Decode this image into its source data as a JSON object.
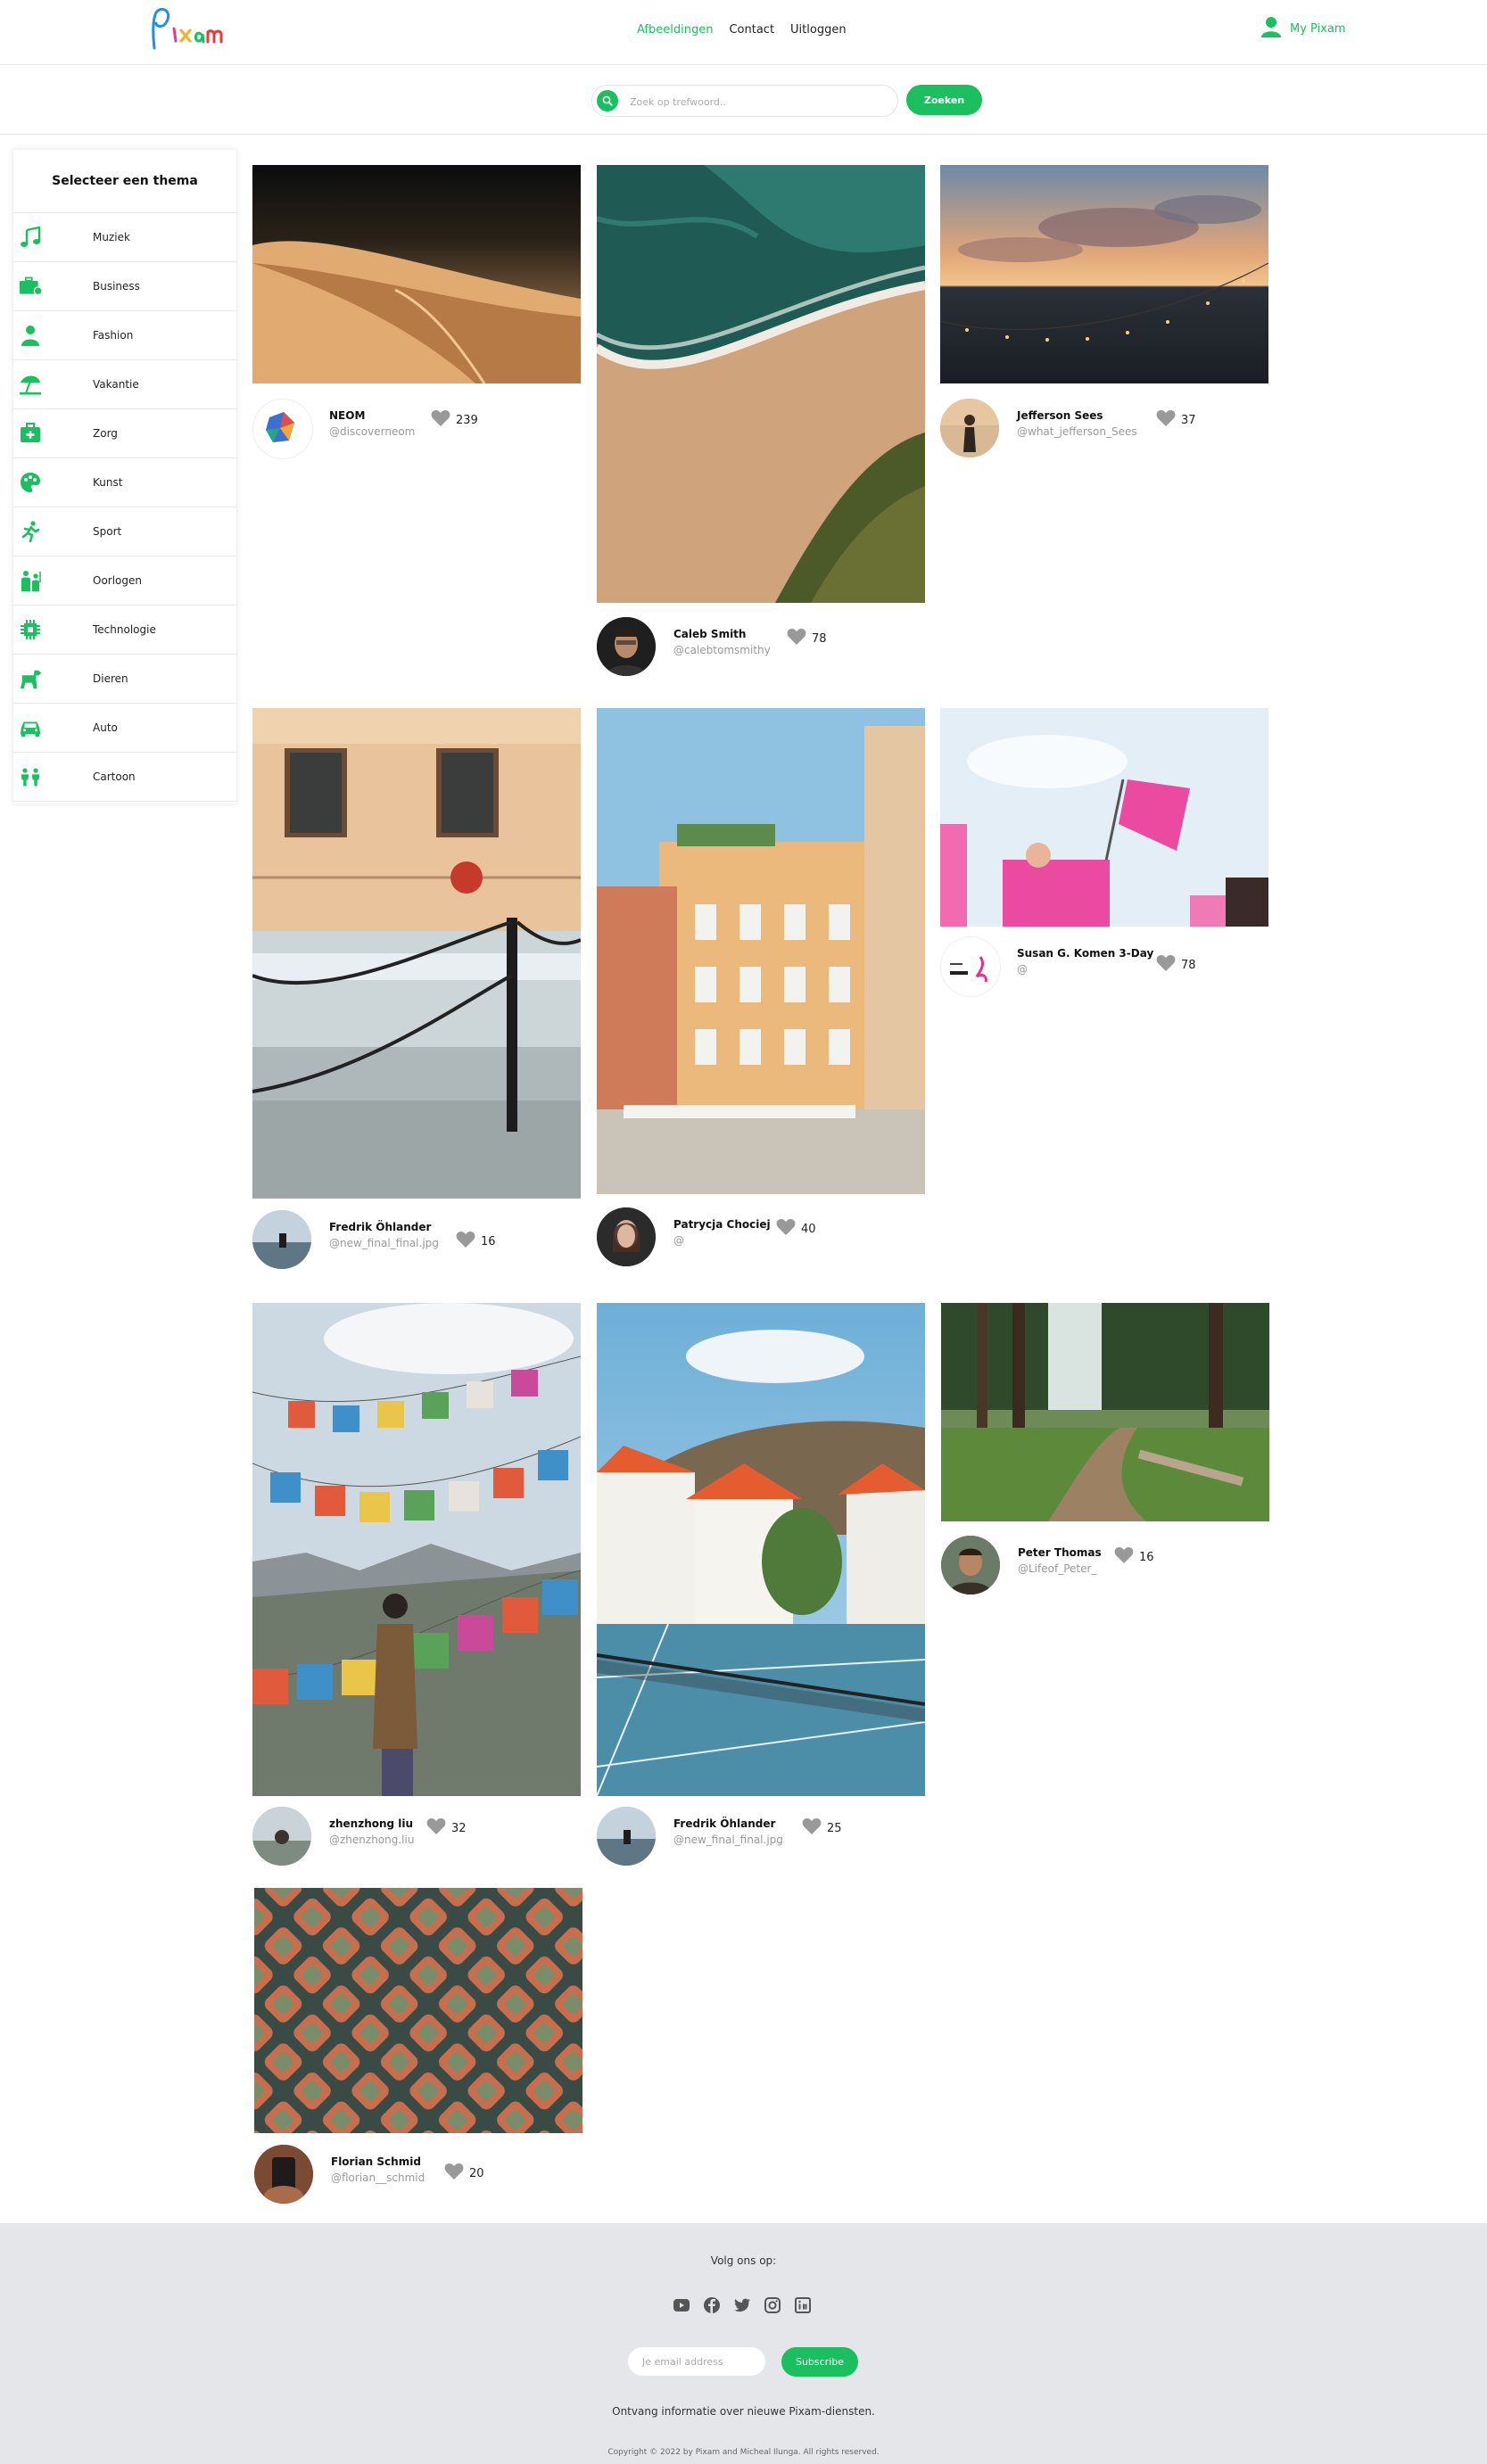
{
  "brand": {
    "logo_text": "Pixam",
    "accent": "#1bbf5f"
  },
  "nav": {
    "items": [
      "Afbeeldingen",
      "Contact",
      "Uitloggen"
    ],
    "active": "Afbeeldingen"
  },
  "account": {
    "label": "My Pixam"
  },
  "search": {
    "placeholder": "Zoek op trefwoord..",
    "button": "Zoeken"
  },
  "sidebar": {
    "title": "Selecteer een thema",
    "items": [
      {
        "label": "Muziek",
        "icon": "music-icon"
      },
      {
        "label": "Business",
        "icon": "briefcase-icon"
      },
      {
        "label": "Fashion",
        "icon": "person-icon"
      },
      {
        "label": "Vakantie",
        "icon": "beach-umbrella-icon"
      },
      {
        "label": "Zorg",
        "icon": "medical-kit-icon"
      },
      {
        "label": "Kunst",
        "icon": "palette-icon"
      },
      {
        "label": "Sport",
        "icon": "runner-icon"
      },
      {
        "label": "Oorlogen",
        "icon": "soldier-icon"
      },
      {
        "label": "Technologie",
        "icon": "chip-icon"
      },
      {
        "label": "Dieren",
        "icon": "dog-icon"
      },
      {
        "label": "Auto",
        "icon": "car-icon"
      },
      {
        "label": "Cartoon",
        "icon": "children-icon"
      }
    ]
  },
  "photos": [
    {
      "name": "NEOM",
      "handle": "@discoverneom",
      "likes": "239"
    },
    {
      "name": "Caleb Smith",
      "handle": "@calebtomsmithy",
      "likes": "78"
    },
    {
      "name": "Jefferson Sees",
      "handle": "@what_jefferson_Sees",
      "likes": "37"
    },
    {
      "name": "Fredrik Öhlander",
      "handle": "@new_final_final.jpg",
      "likes": "16"
    },
    {
      "name": "Patrycja Chociej",
      "handle": "@",
      "likes": "40"
    },
    {
      "name": "Susan G. Komen 3-Day",
      "handle": "@",
      "likes": "78"
    },
    {
      "name": "zhenzhong liu",
      "handle": "@zhenzhong.liu",
      "likes": "32"
    },
    {
      "name": "Fredrik Öhlander",
      "handle": "@new_final_final.jpg",
      "likes": "25"
    },
    {
      "name": "Peter Thomas",
      "handle": "@Lifeof_Peter_",
      "likes": "16"
    },
    {
      "name": "Florian Schmid",
      "handle": "@florian__schmid",
      "likes": "20"
    }
  ],
  "footer": {
    "follow": "Volg ons op:",
    "socials": [
      "youtube-icon",
      "facebook-icon",
      "twitter-icon",
      "instagram-icon",
      "linkedin-icon"
    ],
    "email_placeholder": "Je email address",
    "subscribe": "Subscribe",
    "info": "Ontvang informatie over nieuwe Pixam-diensten.",
    "copyright": "Copyright © 2022 by Pixam and Micheal Ilunga. All rights reserved."
  }
}
